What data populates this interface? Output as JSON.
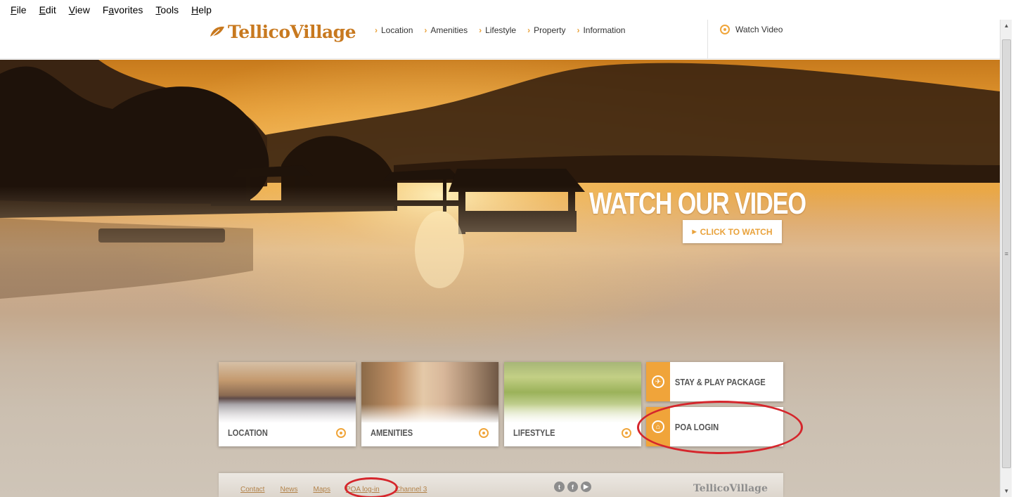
{
  "menubar": {
    "items": [
      {
        "label_u": "F",
        "label_rest": "ile"
      },
      {
        "label_u": "E",
        "label_rest": "dit"
      },
      {
        "label_u": "V",
        "label_rest": "iew"
      },
      {
        "label_pre": "F",
        "label_u": "a",
        "label_rest": "vorites"
      },
      {
        "label_u": "T",
        "label_rest": "ools"
      },
      {
        "label_u": "H",
        "label_rest": "elp"
      }
    ]
  },
  "header": {
    "logo_text": "TellicoVillage",
    "nav": [
      "Location",
      "Amenities",
      "Lifestyle",
      "Property",
      "Information"
    ],
    "watch_video": "Watch Video"
  },
  "hero": {
    "headline": "WATCH OUR VIDEO",
    "cta": "CLICK TO WATCH"
  },
  "tiles": {
    "location": "LOCATION",
    "amenities": "AMENITIES",
    "lifestyle": "LIFESTYLE",
    "stay_play": "STAY & PLAY PACKAGE",
    "poa_login": "POA LOGIN"
  },
  "footer": {
    "links": [
      "Contact",
      "News",
      "Maps",
      "POA log-in",
      "Channel 3"
    ],
    "social": [
      "t",
      "f",
      "▶"
    ],
    "logo_text": "TellicoVillage"
  },
  "colors": {
    "accent": "#f0a43a",
    "logo": "#c8791f",
    "annotation": "#d5262c"
  }
}
